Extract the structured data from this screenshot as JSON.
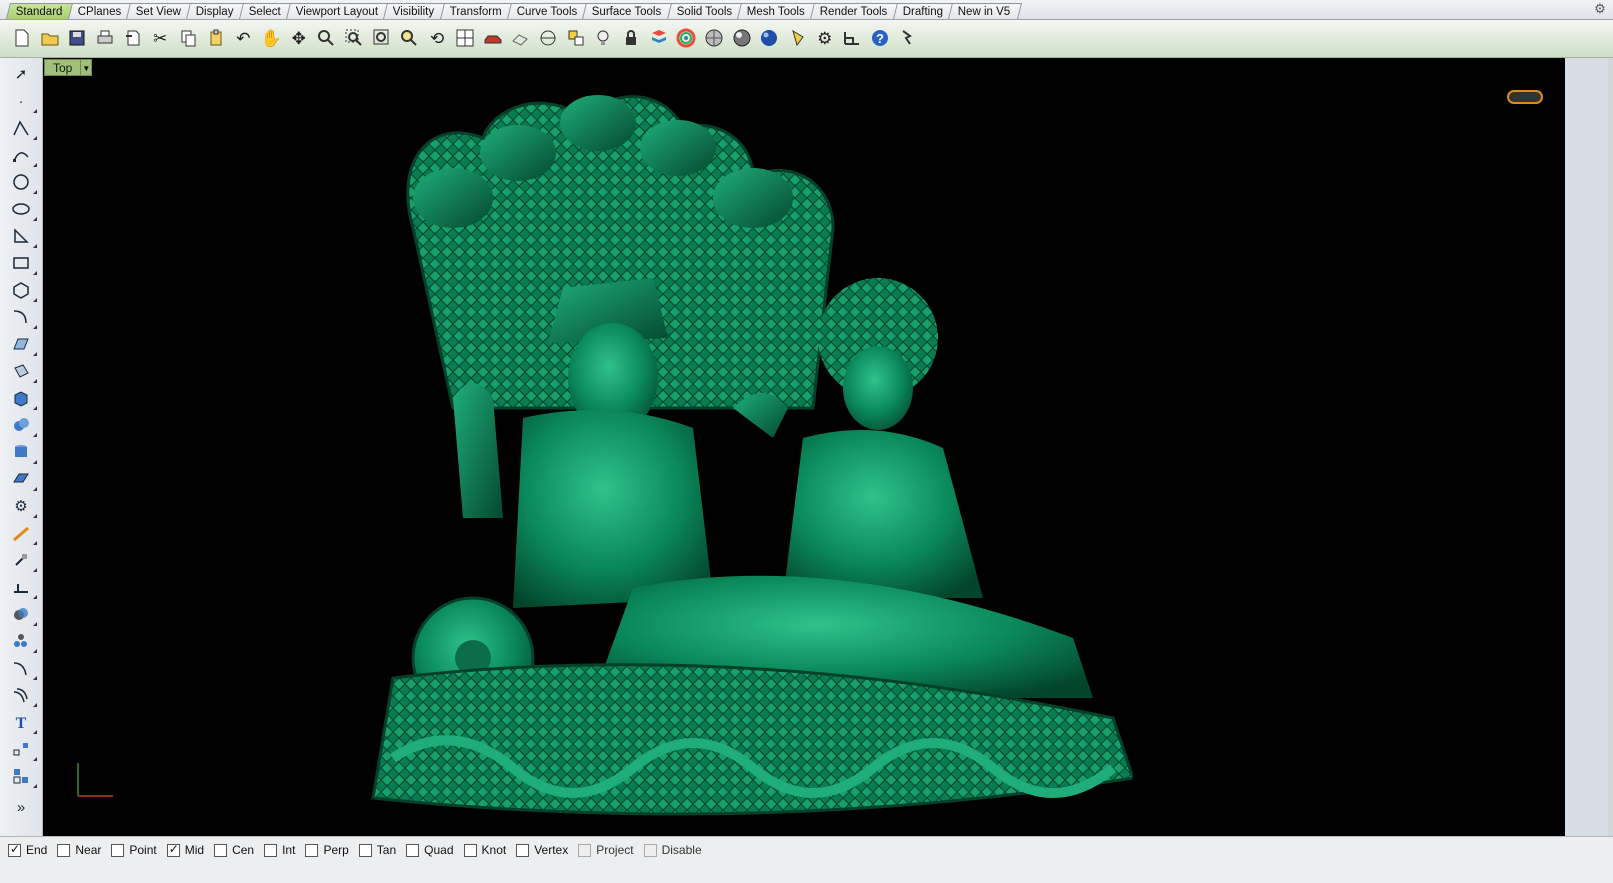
{
  "tabs": [
    {
      "label": "Standard",
      "active": true
    },
    {
      "label": "CPlanes",
      "active": false
    },
    {
      "label": "Set View",
      "active": false
    },
    {
      "label": "Display",
      "active": false
    },
    {
      "label": "Select",
      "active": false
    },
    {
      "label": "Viewport Layout",
      "active": false
    },
    {
      "label": "Visibility",
      "active": false
    },
    {
      "label": "Transform",
      "active": false
    },
    {
      "label": "Curve Tools",
      "active": false
    },
    {
      "label": "Surface Tools",
      "active": false
    },
    {
      "label": "Solid Tools",
      "active": false
    },
    {
      "label": "Mesh Tools",
      "active": false
    },
    {
      "label": "Render Tools",
      "active": false
    },
    {
      "label": "Drafting",
      "active": false
    },
    {
      "label": "New in V5",
      "active": false
    }
  ],
  "toolbar": {
    "icons": [
      "new-file-icon",
      "open-folder-icon",
      "save-icon",
      "print-icon",
      "import-icon",
      "cut-icon",
      "copy-icon",
      "paste-icon",
      "undo-icon",
      "pan-hand-icon",
      "move-view-icon",
      "zoom-dynamic-icon",
      "zoom-window-icon",
      "zoom-extents-icon",
      "zoom-selected-icon",
      "rotate-view-icon",
      "four-viewports-icon",
      "car-render-icon",
      "wireframe-icon",
      "circle-snap-icon",
      "select-points-icon",
      "light-bulb-icon",
      "lock-icon",
      "layer-shield-icon",
      "color-wheel-icon",
      "shaded-sphere-icon",
      "rendered-sphere-icon",
      "blue-sphere-icon",
      "cone-light-icon",
      "options-gear-icon",
      "dimension-icon",
      "help-icon",
      "analyze-icon"
    ]
  },
  "left_tools": [
    "select-arrow-icon",
    "point-icon",
    "polyline-icon",
    "curve-points-icon",
    "circle-icon",
    "ellipse-icon",
    "arc-icon",
    "rectangle-icon",
    "polygon-icon",
    "freeform-curve-icon",
    "surface-icon",
    "extrude-surface-icon",
    "box-solid-icon",
    "sphere-solid-icon",
    "cylinder-solid-icon",
    "mesh-icon",
    "transform-gear-icon",
    "curve-edit-icon",
    "snap-tool-icon",
    "dimension-tool-icon",
    "boolean-icon",
    "array-icon",
    "fillet-curve-icon",
    "offset-icon",
    "text-icon",
    "block-icon",
    "group-icon",
    "more-tools-icon"
  ],
  "viewport": {
    "title": "Top",
    "background": "#000000",
    "model_color": "#0d8a5e"
  },
  "osnaps": [
    {
      "label": "End",
      "checked": true,
      "enabled": true
    },
    {
      "label": "Near",
      "checked": false,
      "enabled": true
    },
    {
      "label": "Point",
      "checked": false,
      "enabled": true
    },
    {
      "label": "Mid",
      "checked": true,
      "enabled": true
    },
    {
      "label": "Cen",
      "checked": false,
      "enabled": true
    },
    {
      "label": "Int",
      "checked": false,
      "enabled": true
    },
    {
      "label": "Perp",
      "checked": false,
      "enabled": true
    },
    {
      "label": "Tan",
      "checked": false,
      "enabled": true
    },
    {
      "label": "Quad",
      "checked": false,
      "enabled": true
    },
    {
      "label": "Knot",
      "checked": false,
      "enabled": true
    },
    {
      "label": "Vertex",
      "checked": false,
      "enabled": true
    },
    {
      "label": "Project",
      "checked": false,
      "enabled": false
    },
    {
      "label": "Disable",
      "checked": false,
      "enabled": false
    }
  ]
}
